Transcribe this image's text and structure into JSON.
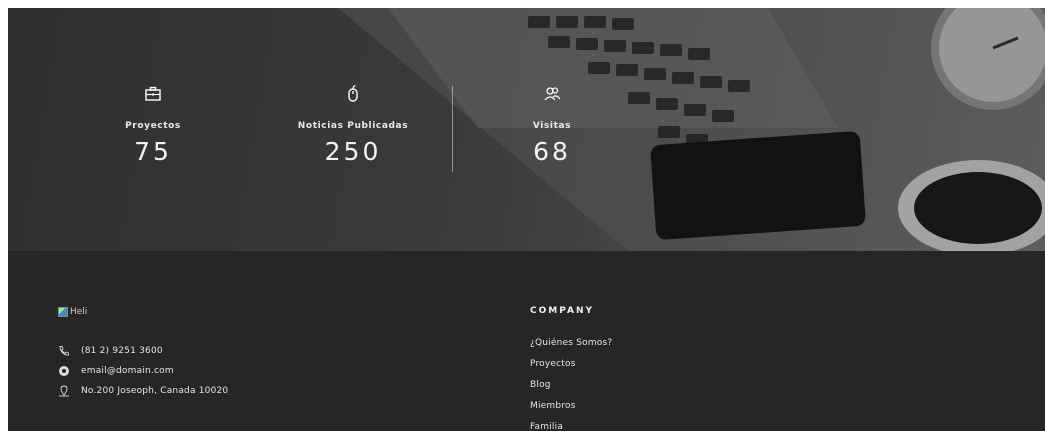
{
  "stats": [
    {
      "icon": "briefcase-icon",
      "label": "Proyectos",
      "value": "75"
    },
    {
      "icon": "mouse-icon",
      "label": "Noticias Publicadas",
      "value": "250"
    },
    {
      "icon": "users-icon",
      "label": "Visitas",
      "value": "68"
    }
  ],
  "footer": {
    "logo_alt": "Heli",
    "contact": {
      "phone": "(81 2) 9251 3600",
      "email": "email@domain.com",
      "address": "No.200 Joseoph, Canada 10020"
    },
    "company": {
      "title": "COMPANY",
      "links": [
        "¿Quiénes Somos?",
        "Proyectos",
        "Blog",
        "Miembros",
        "Familia"
      ]
    }
  },
  "colors": {
    "footer_bg": "#262626",
    "text_light": "#e6e6e6"
  }
}
